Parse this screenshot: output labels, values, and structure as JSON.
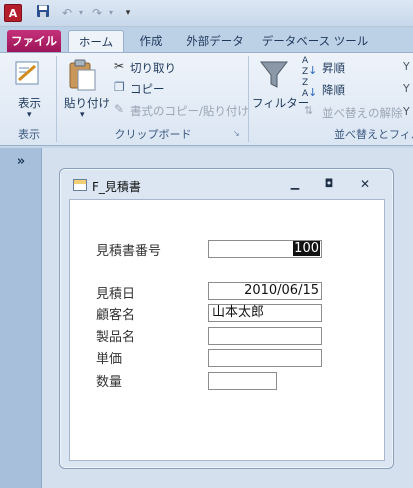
{
  "quick_access": {
    "app_logo": "A"
  },
  "tabs": {
    "file": "ファイル",
    "home": "ホーム",
    "create": "作成",
    "external": "外部データ",
    "database": "データベース ツール"
  },
  "ribbon": {
    "view_label": "表示",
    "view_group": "表示",
    "paste_label": "貼り付け",
    "cut_label": "切り取り",
    "copy_label": "コピー",
    "format_painter_label": "書式のコピー/貼り付け",
    "clipboard_group": "クリップボード",
    "filter_label": "フィルター",
    "sort_asc_label": "昇順",
    "sort_desc_label": "降順",
    "clear_sort_label": "並べ替えの解除",
    "sort_filter_group": "並べ替えとフィルタ"
  },
  "nav": {
    "toggle": "»"
  },
  "form": {
    "title": "F_見積書",
    "fields": {
      "estimate_no_label": "見積書番号",
      "estimate_no_value": "100",
      "estimate_date_label": "見積日",
      "estimate_date_value": "2010/06/15",
      "customer_label": "顧客名",
      "customer_value": "山本太郎",
      "product_label": "製品名",
      "product_value": "",
      "price_label": "単価",
      "price_value": "",
      "quantity_label": "数量",
      "quantity_value": ""
    }
  }
}
